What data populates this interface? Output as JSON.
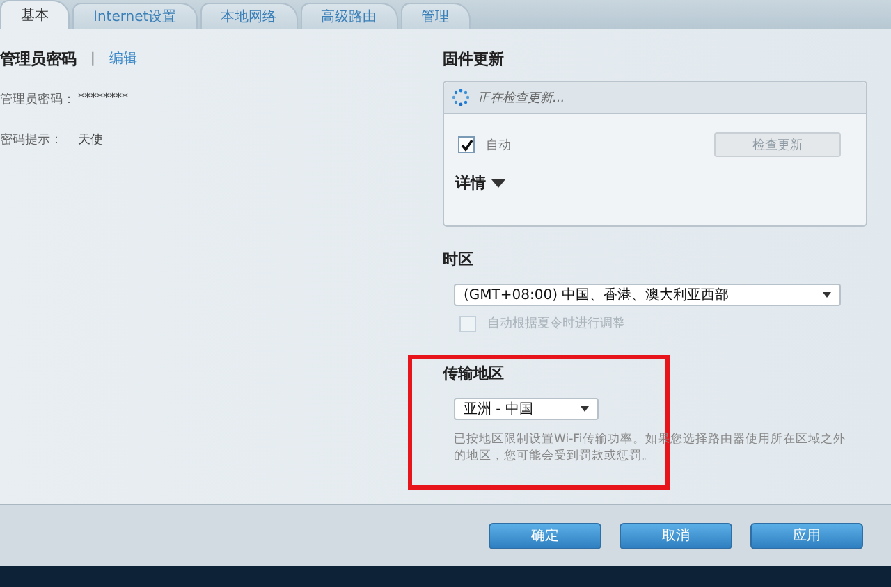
{
  "tabs": [
    {
      "label": "基本",
      "selected": true
    },
    {
      "label": "Internet设置",
      "selected": false
    },
    {
      "label": "本地网络",
      "selected": false
    },
    {
      "label": "高级路由",
      "selected": false
    },
    {
      "label": "管理",
      "selected": false
    }
  ],
  "admin": {
    "title": "管理员密码",
    "separator": "|",
    "edit_link": "编辑",
    "fields": [
      {
        "label": "管理员密码：",
        "value": "********"
      },
      {
        "label": "密码提示：",
        "value": "天使"
      }
    ]
  },
  "firmware": {
    "title": "固件更新",
    "status": "正在检查更新...",
    "auto": {
      "label": "自动",
      "checked": true
    },
    "check_button": {
      "label": "检查更新",
      "disabled": true
    },
    "details": {
      "label": "详情",
      "expanded": false
    }
  },
  "timezone": {
    "title": "时区",
    "value": "(GMT+08:00)  中国、香港、澳大利亚西部",
    "dst": {
      "label": "自动根据夏令时进行调整",
      "checked": false,
      "disabled": true
    }
  },
  "region": {
    "title": "传输地区",
    "value": "亚洲 - 中国",
    "note": "已按地区限制设置Wi-Fi传输功率。如果您选择路由器使用所在区域之外的地区，您可能会受到罚款或惩罚。",
    "highlighted": true
  },
  "buttons": [
    "确定",
    "取消",
    "应用"
  ]
}
